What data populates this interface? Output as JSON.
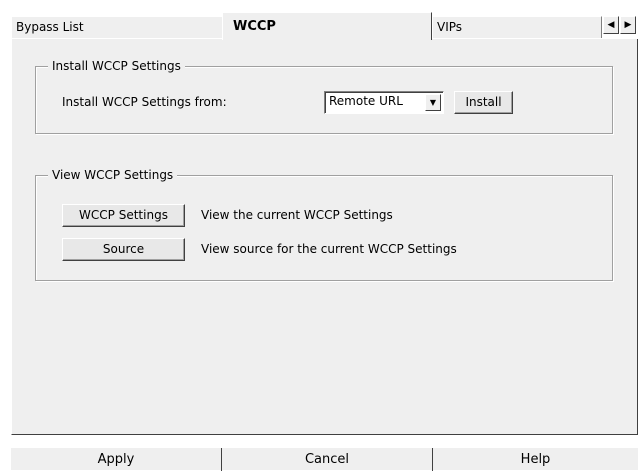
{
  "tabs": [
    {
      "label": "Bypass List",
      "active": false
    },
    {
      "label": "WCCP",
      "active": true
    },
    {
      "label": "VIPs",
      "active": false
    }
  ],
  "tab_scroll": {
    "left_icon": "arrow-left-icon",
    "right_icon": "arrow-right-icon"
  },
  "install_group": {
    "title": "Install WCCP Settings",
    "from_label": "Install WCCP Settings from:",
    "source_select": {
      "value": "Remote URL",
      "icon": "chevron-down-icon"
    },
    "install_button": "Install"
  },
  "view_group": {
    "title": "View WCCP Settings",
    "rows": [
      {
        "button": "WCCP Settings",
        "description": "View the current WCCP Settings"
      },
      {
        "button": "Source",
        "description": "View source for the current WCCP Settings"
      }
    ]
  },
  "footer": {
    "apply": "Apply",
    "cancel": "Cancel",
    "help": "Help"
  }
}
